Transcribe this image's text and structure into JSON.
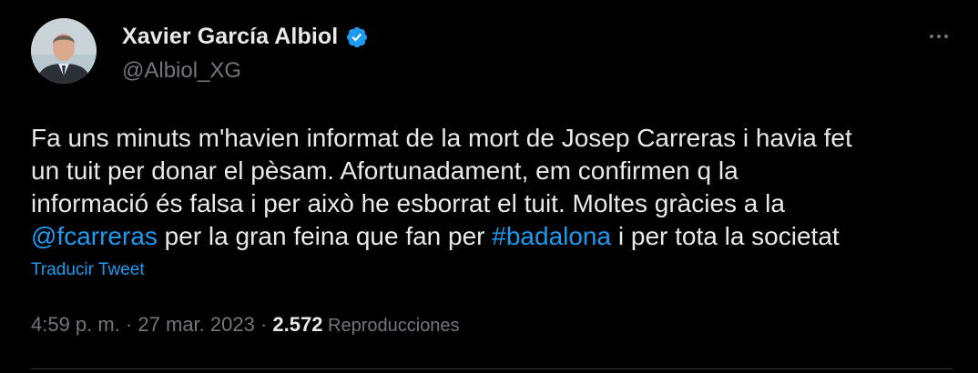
{
  "author": {
    "display_name": "Xavier García Albiol",
    "handle": "@Albiol_XG",
    "verified": true
  },
  "tweet": {
    "line1": "Fa uns minuts m'havien informat de la mort de Josep Carreras i havia fet",
    "line2": "un tuit per donar el pèsam. Afortunadament, em confirmen q la",
    "line3": "informació és falsa i per això he esborrat el tuit. Moltes gràcies a la",
    "mention": "@fcarreras",
    "line4_mid": " per la gran feina que fan per ",
    "hashtag": "#badalona",
    "line4_end": " i per tota la societat"
  },
  "translate_label": "Traducir Tweet",
  "meta": {
    "time": "4:59 p. m.",
    "sep1": " · ",
    "date": "27 mar. 2023",
    "sep2": " · ",
    "views_count": "2.572",
    "views_label": " Reproducciones"
  },
  "colors": {
    "background": "#000000",
    "text": "#e7e9ea",
    "secondary": "#71767b",
    "link": "#1d9bf0"
  },
  "icons": {
    "verified": "verified-badge-icon",
    "more": "more-options-icon"
  }
}
